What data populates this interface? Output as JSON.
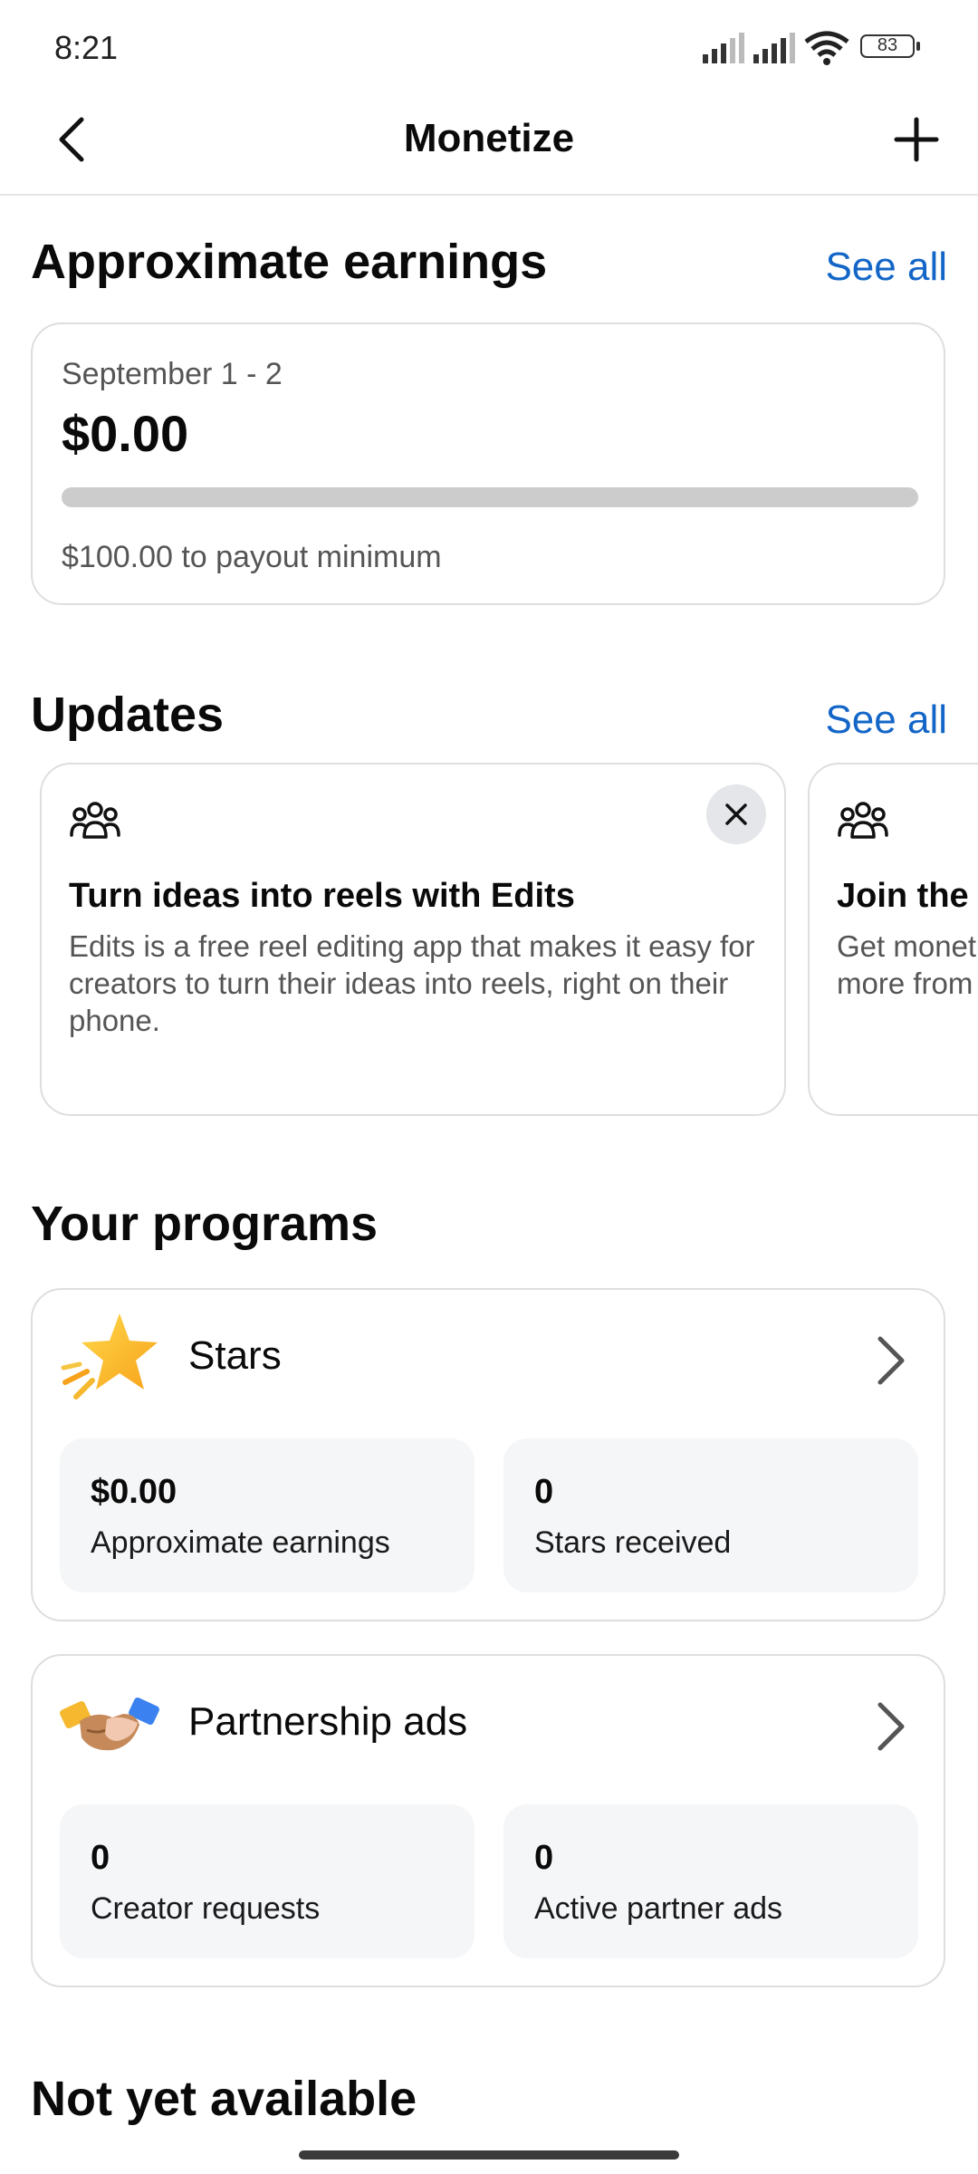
{
  "status_bar": {
    "time": "8:21",
    "battery": "83"
  },
  "header": {
    "title": "Monetize"
  },
  "earnings": {
    "section_title": "Approximate earnings",
    "see_all": "See all",
    "date_range": "September 1 - 2",
    "amount": "$0.00",
    "progress_fraction": 0,
    "payout_note": "$100.00 to payout minimum"
  },
  "updates": {
    "section_title": "Updates",
    "see_all": "See all",
    "cards": [
      {
        "title": "Turn ideas into reels with Edits",
        "description": "Edits is a free reel editing app that makes it easy for creators to turn their ideas into reels, right on their phone."
      },
      {
        "title": "Join the",
        "description": "Get monet more from"
      }
    ]
  },
  "programs": {
    "section_title": "Your programs",
    "items": [
      {
        "name": "Stars",
        "icon": "star-icon",
        "stats": [
          {
            "value": "$0.00",
            "label": "Approximate earnings"
          },
          {
            "value": "0",
            "label": "Stars received"
          }
        ]
      },
      {
        "name": "Partnership ads",
        "icon": "handshake-icon",
        "stats": [
          {
            "value": "0",
            "label": "Creator requests"
          },
          {
            "value": "0",
            "label": "Active partner ads"
          }
        ]
      }
    ]
  },
  "not_available": {
    "section_title": "Not yet available"
  },
  "colors": {
    "accent": "#1366c7",
    "progress_track": "#cccccc",
    "stat_background": "#f5f6f8"
  }
}
